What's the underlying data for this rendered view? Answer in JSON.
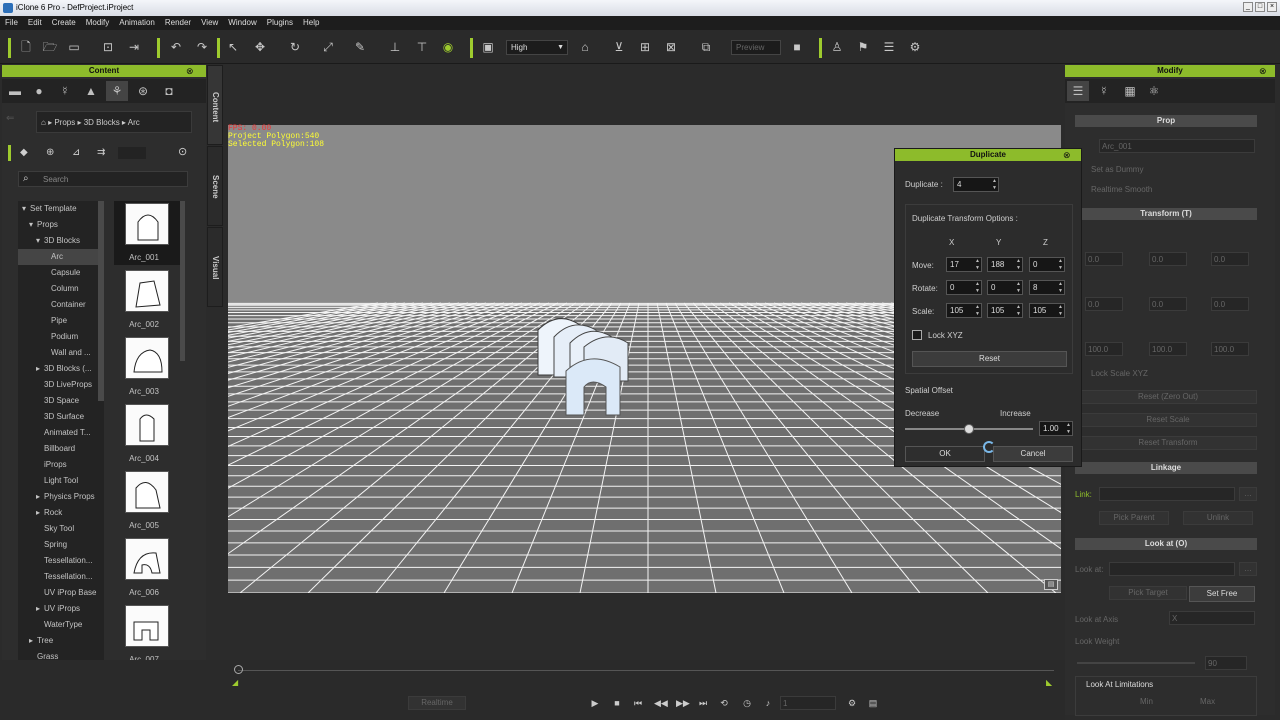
{
  "window": {
    "title": "iClone 6 Pro - DefProject.iProject",
    "min": "_",
    "max": "□",
    "close": "×"
  },
  "menu": [
    "File",
    "Edit",
    "Create",
    "Modify",
    "Animation",
    "Render",
    "View",
    "Window",
    "Plugins",
    "Help"
  ],
  "toolbar": {
    "quality": "High",
    "preview": "Preview"
  },
  "content_panel": {
    "title": "Content",
    "breadcrumb": [
      "Props",
      "3D Blocks",
      "Arc"
    ],
    "search_placeholder": "Search",
    "tree": [
      {
        "label": "Set Template",
        "level": 0,
        "arrow": "▾"
      },
      {
        "label": "Props",
        "level": 1,
        "arrow": "▾"
      },
      {
        "label": "3D Blocks",
        "level": 2,
        "arrow": "▾"
      },
      {
        "label": "Arc",
        "level": 3,
        "arrow": "",
        "selected": true
      },
      {
        "label": "Capsule",
        "level": 3,
        "arrow": ""
      },
      {
        "label": "Column",
        "level": 3,
        "arrow": ""
      },
      {
        "label": "Container",
        "level": 3,
        "arrow": ""
      },
      {
        "label": "Pipe",
        "level": 3,
        "arrow": ""
      },
      {
        "label": "Podium",
        "level": 3,
        "arrow": ""
      },
      {
        "label": "Wall and ...",
        "level": 3,
        "arrow": ""
      },
      {
        "label": "3D Blocks (...",
        "level": 2,
        "arrow": "▸"
      },
      {
        "label": "3D LiveProps",
        "level": 2,
        "arrow": ""
      },
      {
        "label": "3D Space",
        "level": 2,
        "arrow": ""
      },
      {
        "label": "3D Surface",
        "level": 2,
        "arrow": ""
      },
      {
        "label": "Animated T...",
        "level": 2,
        "arrow": ""
      },
      {
        "label": "Billboard",
        "level": 2,
        "arrow": ""
      },
      {
        "label": "iProps",
        "level": 2,
        "arrow": ""
      },
      {
        "label": "Light Tool",
        "level": 2,
        "arrow": ""
      },
      {
        "label": "Physics Props",
        "level": 2,
        "arrow": "▸"
      },
      {
        "label": "Rock",
        "level": 2,
        "arrow": "▸"
      },
      {
        "label": "Sky Tool",
        "level": 2,
        "arrow": ""
      },
      {
        "label": "Spring",
        "level": 2,
        "arrow": ""
      },
      {
        "label": "Tessellation...",
        "level": 2,
        "arrow": ""
      },
      {
        "label": "Tessellation...",
        "level": 2,
        "arrow": ""
      },
      {
        "label": "UV iProp Base",
        "level": 2,
        "arrow": ""
      },
      {
        "label": "UV iProps",
        "level": 2,
        "arrow": "▸"
      },
      {
        "label": "WaterType",
        "level": 2,
        "arrow": ""
      },
      {
        "label": "Tree",
        "level": 1,
        "arrow": "▸"
      },
      {
        "label": "Grass",
        "level": 1,
        "arrow": ""
      }
    ],
    "items": [
      "Arc_001",
      "Arc_002",
      "Arc_003",
      "Arc_004",
      "Arc_005",
      "Arc_006",
      "Arc_007"
    ]
  },
  "side_tabs": [
    "Content",
    "Scene",
    "Visual"
  ],
  "viewport": {
    "stats": [
      "FPS: 0.00",
      "Project Polygon:540",
      "Selected Polygon:108"
    ]
  },
  "duplicate": {
    "title": "Duplicate",
    "count_label": "Duplicate :",
    "count": "4",
    "options_label": "Duplicate Transform Options :",
    "axes": [
      "X",
      "Y",
      "Z"
    ],
    "rows": [
      {
        "label": "Move:",
        "values": [
          "17",
          "188",
          "0"
        ]
      },
      {
        "label": "Rotate:",
        "values": [
          "0",
          "0",
          "8"
        ]
      },
      {
        "label": "Scale:",
        "values": [
          "105",
          "105",
          "105"
        ]
      }
    ],
    "lock_xyz": "Lock XYZ",
    "reset": "Reset",
    "spatial_offset": "Spatial Offset",
    "decrease": "Decrease",
    "increase": "Increase",
    "offset_value": "1.00",
    "offset_level": 0.5,
    "ok": "OK",
    "cancel": "Cancel"
  },
  "modify_panel": {
    "title": "Modify",
    "prop_header": "Prop",
    "name": "Arc_001",
    "set_dummy": "Set as Dummy",
    "realtime_smooth": "Realtime Smooth",
    "transform_header": "Transform  (T)",
    "move": [
      "0.0",
      "0.0",
      "0.0"
    ],
    "rotate": [
      "0.0",
      "0.0",
      "0.0"
    ],
    "scale": [
      "100.0",
      "100.0",
      "100.0"
    ],
    "lock_scale": "Lock Scale XYZ",
    "reset_zero": "Reset (Zero Out)",
    "reset_scale": "Reset Scale",
    "reset_transform": "Reset Transform",
    "linkage_header": "Linkage",
    "link_label": "Link:",
    "pick_parent": "Pick Parent",
    "unlink": "Unlink",
    "lookat_header": "Look at  (O)",
    "look_at": "Look at:",
    "pick_target": "Pick Target",
    "set_free": "Set Free",
    "look_at_axis": "Look at Axis",
    "axis_value": "X",
    "look_weight": "Look Weight",
    "weight_value": "90",
    "limitations": "Look At Limitations",
    "min": "Min",
    "max": "Max"
  },
  "bottom": {
    "realtime": "Realtime",
    "frame": "1"
  }
}
